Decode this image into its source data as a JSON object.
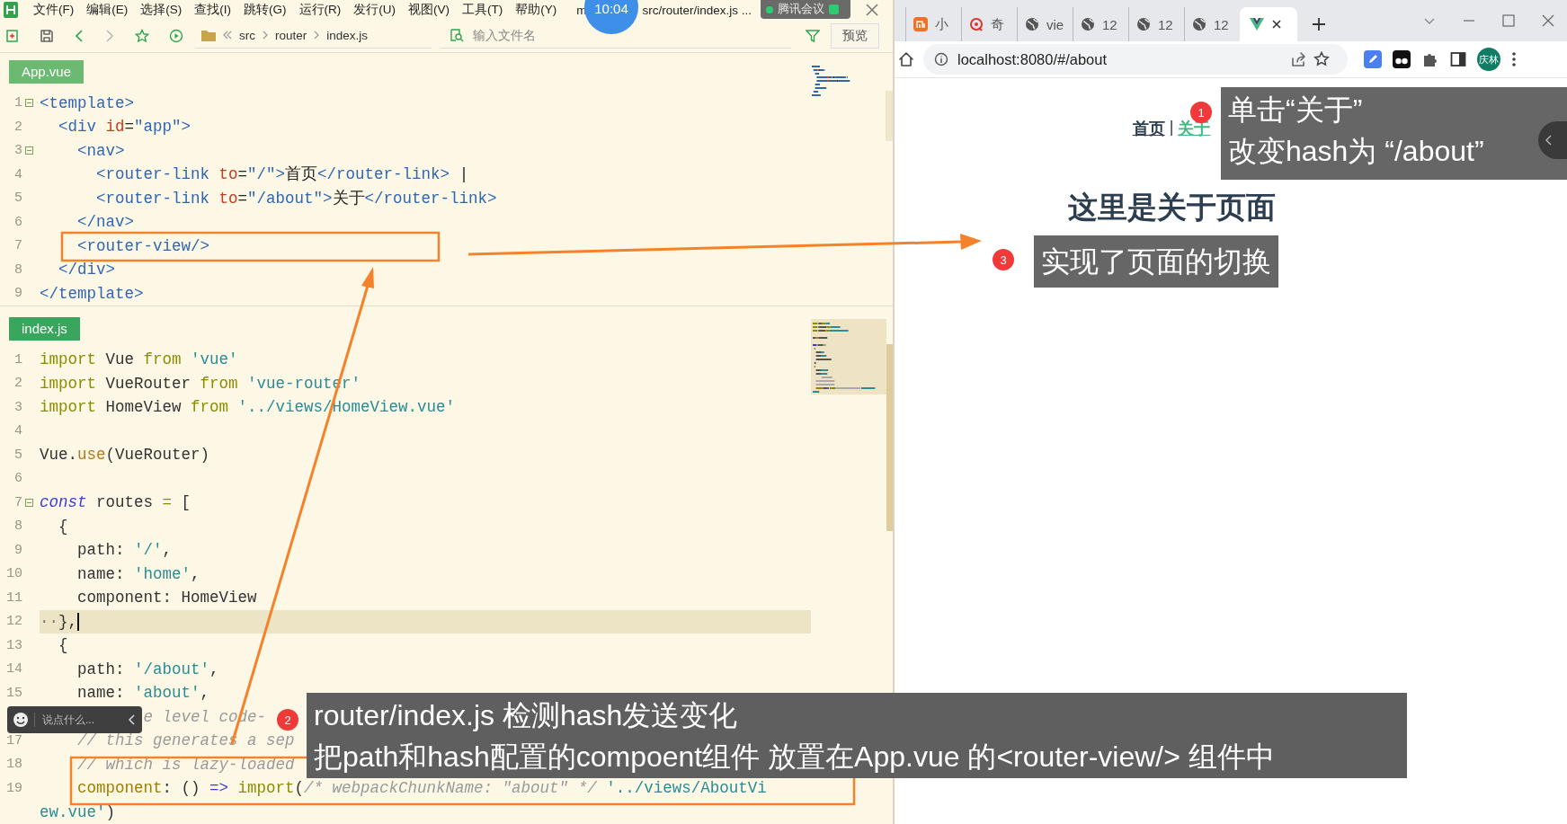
{
  "editor": {
    "menu": [
      "文件(F)",
      "编辑(E)",
      "选择(S)",
      "查找(I)",
      "跳转(G)",
      "运行(R)",
      "发行(U)",
      "视图(V)",
      "工具(T)",
      "帮助(Y)"
    ],
    "title_fragment": "m",
    "file_path": "src/router/index.js ...",
    "toolbar": {
      "breadcrumb": [
        "src",
        "router",
        "index.js"
      ],
      "search": {
        "placeholder": "输入文件名"
      },
      "preview_button": "预览"
    },
    "panels": [
      {
        "file": "App.vue",
        "lines": [
          {
            "number": "1",
            "fold": true,
            "current": false,
            "tokens": [
              {
                "kind": "tag",
                "text": "<template>"
              }
            ]
          },
          {
            "number": "2",
            "fold": false,
            "current": false,
            "tokens": [
              {
                "kind": "tag",
                "text": "  <div "
              },
              {
                "kind": "attr",
                "text": "id"
              },
              {
                "kind": "punct",
                "text": "="
              },
              {
                "kind": "aval",
                "text": "\"app\""
              },
              {
                "kind": "tag",
                "text": ">"
              }
            ]
          },
          {
            "number": "3",
            "fold": true,
            "current": false,
            "tokens": [
              {
                "kind": "tag",
                "text": "    <nav>"
              }
            ]
          },
          {
            "number": "4",
            "fold": false,
            "current": false,
            "tokens": [
              {
                "kind": "tag",
                "text": "      <router-link "
              },
              {
                "kind": "attr",
                "text": "to"
              },
              {
                "kind": "punct",
                "text": "="
              },
              {
                "kind": "aval",
                "text": "\"/\""
              },
              {
                "kind": "tag",
                "text": ">"
              },
              {
                "kind": "text",
                "text": "首页"
              },
              {
                "kind": "tag",
                "text": "</router-link>"
              },
              {
                "kind": "text",
                "text": " |"
              }
            ]
          },
          {
            "number": "5",
            "fold": false,
            "current": false,
            "tokens": [
              {
                "kind": "tag",
                "text": "      <router-link "
              },
              {
                "kind": "attr",
                "text": "to"
              },
              {
                "kind": "punct",
                "text": "="
              },
              {
                "kind": "aval",
                "text": "\"/about\""
              },
              {
                "kind": "tag",
                "text": ">"
              },
              {
                "kind": "text",
                "text": "关于"
              },
              {
                "kind": "tag",
                "text": "</router-link>"
              }
            ]
          },
          {
            "number": "6",
            "fold": false,
            "current": false,
            "tokens": [
              {
                "kind": "tag",
                "text": "    </nav>"
              }
            ]
          },
          {
            "number": "7",
            "fold": false,
            "current": false,
            "tokens": [
              {
                "kind": "tag",
                "text": "    <router-view/>"
              }
            ]
          },
          {
            "number": "8",
            "fold": false,
            "current": false,
            "tokens": [
              {
                "kind": "tag",
                "text": "  </div>"
              }
            ]
          },
          {
            "number": "9",
            "fold": false,
            "current": false,
            "tokens": [
              {
                "kind": "tag",
                "text": "</template>"
              }
            ]
          }
        ]
      },
      {
        "file": "index.js",
        "lines": [
          {
            "number": "1",
            "fold": false,
            "current": false,
            "tokens": [
              {
                "kind": "kw",
                "text": "import"
              },
              {
                "kind": "plain",
                "text": " Vue "
              },
              {
                "kind": "kw",
                "text": "from "
              },
              {
                "kind": "str",
                "text": "'vue'"
              }
            ]
          },
          {
            "number": "2",
            "fold": false,
            "current": false,
            "tokens": [
              {
                "kind": "kw",
                "text": "import"
              },
              {
                "kind": "plain",
                "text": " VueRouter "
              },
              {
                "kind": "kw",
                "text": "from "
              },
              {
                "kind": "str",
                "text": "'vue-router'"
              }
            ]
          },
          {
            "number": "3",
            "fold": false,
            "current": false,
            "tokens": [
              {
                "kind": "kw",
                "text": "import"
              },
              {
                "kind": "plain",
                "text": " HomeView "
              },
              {
                "kind": "kw",
                "text": "from "
              },
              {
                "kind": "str",
                "text": "'../views/HomeView.vue'"
              }
            ]
          },
          {
            "number": "4",
            "fold": false,
            "current": false
          },
          {
            "number": "5",
            "fold": false,
            "current": false,
            "tokens": [
              {
                "kind": "plain",
                "text": "Vue."
              },
              {
                "kind": "fn",
                "text": "use"
              },
              {
                "kind": "plain",
                "text": "(VueRouter)"
              }
            ]
          },
          {
            "number": "6",
            "fold": false,
            "current": false
          },
          {
            "number": "7",
            "fold": true,
            "current": false,
            "tokens": [
              {
                "kind": "decl",
                "text": "const"
              },
              {
                "kind": "plain",
                "text": " routes "
              },
              {
                "kind": "op",
                "text": "="
              },
              {
                "kind": "plain",
                "text": " ["
              }
            ]
          },
          {
            "number": "8",
            "fold": false,
            "current": false,
            "tokens": [
              {
                "kind": "plain",
                "text": "  {"
              }
            ]
          },
          {
            "number": "9",
            "fold": false,
            "current": false,
            "tokens": [
              {
                "kind": "plain",
                "text": "    path: "
              },
              {
                "kind": "str",
                "text": "'/'"
              },
              {
                "kind": "plain",
                "text": ","
              }
            ]
          },
          {
            "number": "10",
            "fold": false,
            "current": false,
            "tokens": [
              {
                "kind": "plain",
                "text": "    name: "
              },
              {
                "kind": "str",
                "text": "'home'"
              },
              {
                "kind": "plain",
                "text": ","
              }
            ]
          },
          {
            "number": "11",
            "fold": false,
            "current": false,
            "tokens": [
              {
                "kind": "plain",
                "text": "    component: HomeView"
              }
            ]
          },
          {
            "number": "12",
            "fold": false,
            "current": true,
            "tokens": [
              {
                "kind": "dots",
                "text": "··"
              },
              {
                "kind": "plain",
                "text": "},"
              }
            ]
          },
          {
            "number": "13",
            "fold": false,
            "current": false,
            "tokens": [
              {
                "kind": "plain",
                "text": "  {"
              }
            ]
          },
          {
            "number": "14",
            "fold": false,
            "current": false,
            "tokens": [
              {
                "kind": "plain",
                "text": "    path: "
              },
              {
                "kind": "str",
                "text": "'/about'"
              },
              {
                "kind": "plain",
                "text": ","
              }
            ]
          },
          {
            "number": "15",
            "fold": false,
            "current": false,
            "tokens": [
              {
                "kind": "plain",
                "text": "    name: "
              },
              {
                "kind": "str",
                "text": "'about'"
              },
              {
                "kind": "plain",
                "text": ","
              }
            ]
          },
          {
            "fold": false,
            "current": false,
            "tokens": [
              {
                "kind": "comment",
                "text": "           e level code-"
              }
            ]
          },
          {
            "number": "17",
            "fold": false,
            "current": false,
            "tokens": [
              {
                "kind": "comment",
                "text": "    // this generates a sep"
              }
            ]
          },
          {
            "number": "18",
            "fold": false,
            "current": false,
            "tokens": [
              {
                "kind": "comment",
                "text": "    // which is lazy-loaded"
              }
            ]
          },
          {
            "number": "19",
            "fold": false,
            "current": false,
            "tokens": [
              {
                "kind": "prop",
                "text": "    component"
              },
              {
                "kind": "plain",
                "text": ": () "
              },
              {
                "kind": "arrow",
                "text": "=>"
              },
              {
                "kind": "kw",
                "text": " import"
              },
              {
                "kind": "plain",
                "text": "("
              },
              {
                "kind": "comment",
                "text": "/* webpackChunkName: \"about\" */"
              },
              {
                "kind": "str",
                "text": " '../views/AboutVi"
              }
            ]
          },
          {
            "fold": false,
            "current": false,
            "tokens": [
              {
                "kind": "str",
                "text": "ew.vue'"
              },
              {
                "kind": "plain",
                "text": ")"
              }
            ]
          }
        ]
      }
    ]
  },
  "meeting": {
    "time": "10:04",
    "name": "腾讯会议"
  },
  "chat_box": {
    "placeholder": "说点什么..."
  },
  "browser": {
    "tabs": [
      {
        "kind": "mi",
        "label": "小",
        "selected": false
      },
      {
        "kind": "target",
        "label": "奇",
        "selected": false
      },
      {
        "kind": "globe",
        "label": "vie",
        "selected": false
      },
      {
        "kind": "globe",
        "label": "12",
        "selected": false
      },
      {
        "kind": "globe",
        "label": "12",
        "selected": false
      },
      {
        "kind": "globe",
        "label": "12",
        "selected": false
      },
      {
        "kind": "vue",
        "selected": true
      }
    ],
    "url": "localhost:8080/#/about",
    "profile": "庆林",
    "page": {
      "nav": [
        {
          "label": "首页",
          "selected": false
        },
        {
          "label": "关于",
          "selected": true
        }
      ],
      "separator": "|",
      "heading": "这里是关于页面"
    }
  },
  "annotations": [
    {
      "number": "1",
      "lines": [
        "单击“关于”",
        "改变hash为 “/about”"
      ]
    },
    {
      "number": "3",
      "lines": [
        "实现了页面的切换"
      ]
    },
    {
      "number": "2",
      "lines": [
        "router/index.js 检测hash发送变化",
        "把path和hash配置的compoent组件 放置在App.vue 的<router-view/> 组件中"
      ]
    }
  ]
}
